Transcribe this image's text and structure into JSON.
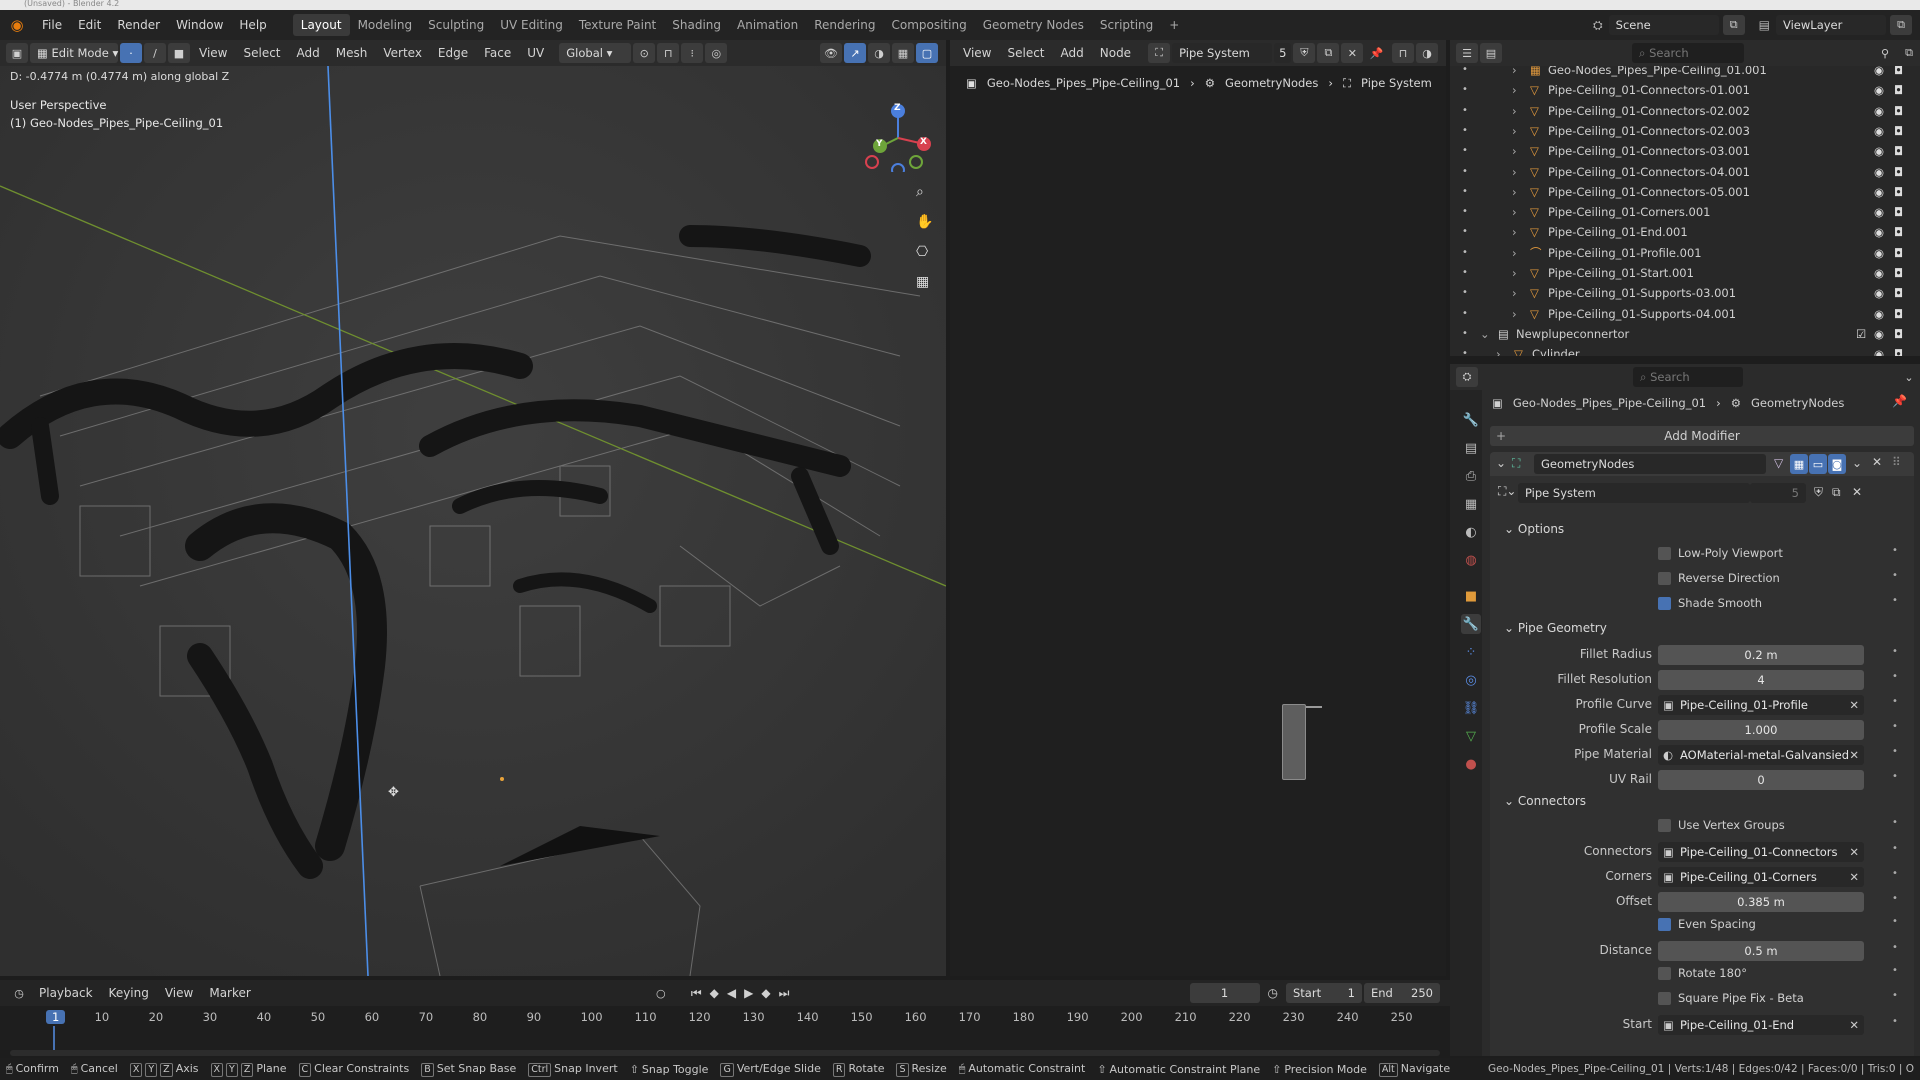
{
  "window": {
    "title": "(Unsaved) - Blender 4.2"
  },
  "menu": {
    "items": [
      "File",
      "Edit",
      "Render",
      "Window",
      "Help"
    ],
    "workspaces": [
      "Layout",
      "Modeling",
      "Sculpting",
      "UV Editing",
      "Texture Paint",
      "Shading",
      "Animation",
      "Rendering",
      "Compositing",
      "Geometry Nodes",
      "Scripting"
    ],
    "active_workspace": "Layout",
    "add_symbol": "+",
    "scene": "Scene",
    "view_layer": "ViewLayer"
  },
  "viewport": {
    "mode": "Edit Mode",
    "menus": [
      "View",
      "Select",
      "Add",
      "Mesh",
      "Vertex",
      "Edge",
      "Face",
      "UV"
    ],
    "orientation": "Global",
    "info_text": "D: -0.4774 m (0.4774 m) along global Z",
    "perspective": "User Perspective",
    "object_label": "(1) Geo-Nodes_Pipes_Pipe-Ceiling_01",
    "gizmo_axes": {
      "x": "X",
      "y": "Y",
      "z": "Z"
    }
  },
  "node_editor": {
    "menus": [
      "View",
      "Select",
      "Add",
      "Node"
    ],
    "node_group": "Pipe System",
    "user_count": "5",
    "breadcrumb": [
      "Geo-Nodes_Pipes_Pipe-Ceiling_01",
      "GeometryNodes",
      "Pipe System"
    ]
  },
  "outliner": {
    "search_placeholder": "Search",
    "rows": [
      {
        "label": "Geo-Nodes_Pipes_Pipe-Ceiling_01.001"
      },
      {
        "label": "Pipe-Ceiling_01-Connectors-01.001"
      },
      {
        "label": "Pipe-Ceiling_01-Connectors-02.002"
      },
      {
        "label": "Pipe-Ceiling_01-Connectors-02.003"
      },
      {
        "label": "Pipe-Ceiling_01-Connectors-03.001"
      },
      {
        "label": "Pipe-Ceiling_01-Connectors-04.001"
      },
      {
        "label": "Pipe-Ceiling_01-Connectors-05.001"
      },
      {
        "label": "Pipe-Ceiling_01-Corners.001"
      },
      {
        "label": "Pipe-Ceiling_01-End.001"
      },
      {
        "label": "Pipe-Ceiling_01-Profile.001"
      },
      {
        "label": "Pipe-Ceiling_01-Start.001"
      },
      {
        "label": "Pipe-Ceiling_01-Supports-03.001"
      },
      {
        "label": "Pipe-Ceiling_01-Supports-04.001"
      },
      {
        "label": "Newplupeconnertor"
      },
      {
        "label": "Cylinder"
      }
    ]
  },
  "properties": {
    "search_placeholder": "Search",
    "breadcrumb": [
      "Geo-Nodes_Pipes_Pipe-Ceiling_01",
      "GeometryNodes"
    ],
    "add_modifier": "Add Modifier",
    "modifier_name": "GeometryNodes",
    "node_group": "Pipe System",
    "node_group_users": "5",
    "sections": {
      "options": "Options",
      "pipe_geometry": "Pipe Geometry",
      "connectors": "Connectors"
    },
    "options": {
      "low_poly": {
        "label": "Low-Poly Viewport",
        "checked": false
      },
      "reverse": {
        "label": "Reverse Direction",
        "checked": false
      },
      "shade_smooth": {
        "label": "Shade Smooth",
        "checked": true
      }
    },
    "pipe_geometry": {
      "fillet_radius": {
        "label": "Fillet Radius",
        "value": "0.2 m"
      },
      "fillet_resolution": {
        "label": "Fillet Resolution",
        "value": "4"
      },
      "profile_curve": {
        "label": "Profile Curve",
        "value": "Pipe-Ceiling_01-Profile"
      },
      "profile_scale": {
        "label": "Profile Scale",
        "value": "1.000"
      },
      "pipe_material": {
        "label": "Pipe Material",
        "value": "AOMaterial-metal-Galvansied"
      },
      "uv_rail": {
        "label": "UV Rail",
        "value": "0"
      }
    },
    "connectors": {
      "use_vertex_groups": {
        "label": "Use Vertex Groups",
        "checked": false
      },
      "connectors": {
        "label": "Connectors",
        "value": "Pipe-Ceiling_01-Connectors"
      },
      "corners": {
        "label": "Corners",
        "value": "Pipe-Ceiling_01-Corners"
      },
      "offset": {
        "label": "Offset",
        "value": "0.385 m"
      },
      "even_spacing": {
        "label": "Even Spacing",
        "checked": true
      },
      "distance": {
        "label": "Distance",
        "value": "0.5 m"
      },
      "rotate": {
        "label": "Rotate 180°",
        "checked": false
      },
      "square_fix": {
        "label": "Square Pipe Fix - Beta",
        "checked": false
      },
      "start": {
        "label": "Start",
        "value": "Pipe-Ceiling_01-End"
      }
    }
  },
  "timeline": {
    "menus": [
      "Playback",
      "Keying",
      "View",
      "Marker"
    ],
    "current_frame": "1",
    "start_label": "Start",
    "start": "1",
    "end_label": "End",
    "end": "250",
    "ticks": [
      "1",
      "10",
      "20",
      "30",
      "40",
      "50",
      "60",
      "70",
      "80",
      "90",
      "100",
      "110",
      "120",
      "130",
      "140",
      "150",
      "160",
      "170",
      "180",
      "190",
      "200",
      "210",
      "220",
      "230",
      "240",
      "250"
    ]
  },
  "status": {
    "items": [
      {
        "key": "",
        "label": "Confirm"
      },
      {
        "key": "",
        "label": "Cancel"
      },
      {
        "key": "X Y Z",
        "label": "Axis"
      },
      {
        "key": "X Y Z",
        "label": "Plane"
      },
      {
        "key": "C",
        "label": "Clear Constraints"
      },
      {
        "key": "B",
        "label": "Set Snap Base"
      },
      {
        "key": "Ctrl",
        "label": "Snap Invert"
      },
      {
        "key": "",
        "label": "Snap Toggle"
      },
      {
        "key": "G",
        "label": "Vert/Edge Slide"
      },
      {
        "key": "R",
        "label": "Rotate"
      },
      {
        "key": "S",
        "label": "Resize"
      },
      {
        "key": "",
        "label": "Automatic Constraint"
      },
      {
        "key": "",
        "label": "Automatic Constraint Plane"
      },
      {
        "key": "",
        "label": "Precision Mode"
      },
      {
        "key": "Alt",
        "label": "Navigate"
      }
    ],
    "stats": "Geo-Nodes_Pipes_Pipe-Ceiling_01 | Verts:1/48 | Edges:0/42 | Faces:0/0 | Tris:0 | O"
  }
}
